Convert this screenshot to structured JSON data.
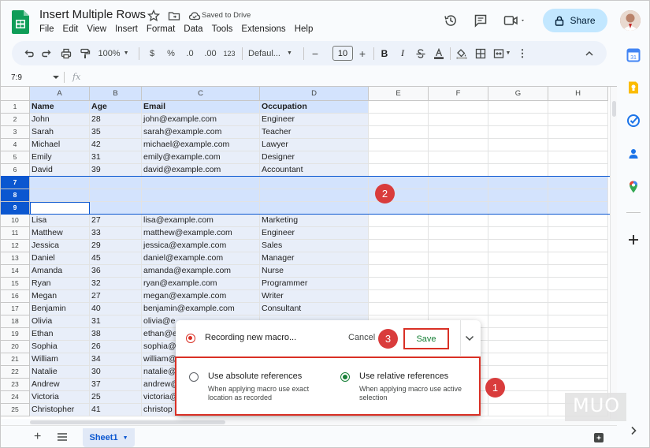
{
  "header": {
    "doc_title": "Insert Multiple Rows",
    "saved_status": "Saved to Drive",
    "share_label": "Share",
    "menu": [
      "File",
      "Edit",
      "View",
      "Insert",
      "Format",
      "Data",
      "Tools",
      "Extensions",
      "Help"
    ]
  },
  "toolbar": {
    "zoom": "100%",
    "currency": "$",
    "percent": "%",
    "decimal_decrease": ".0",
    "decimal_increase": ".00",
    "number_format": "123",
    "font": "Defaul...",
    "font_size": "10",
    "bold": "B",
    "italic": "I",
    "minus": "−",
    "plus": "+"
  },
  "formula_bar": {
    "name_box": "7:9",
    "fx": "fx"
  },
  "grid": {
    "columns": [
      "A",
      "B",
      "C",
      "D",
      "E",
      "F",
      "G",
      "H"
    ],
    "rows": [
      {
        "num": "1",
        "cells": [
          "Name",
          "Age",
          "Email",
          "Occupation"
        ]
      },
      {
        "num": "2",
        "cells": [
          "John",
          "28",
          "john@example.com",
          "Engineer"
        ]
      },
      {
        "num": "3",
        "cells": [
          "Sarah",
          "35",
          "sarah@example.com",
          "Teacher"
        ]
      },
      {
        "num": "4",
        "cells": [
          "Michael",
          "42",
          "michael@example.com",
          "Lawyer"
        ]
      },
      {
        "num": "5",
        "cells": [
          "Emily",
          "31",
          "emily@example.com",
          "Designer"
        ]
      },
      {
        "num": "6",
        "cells": [
          "David",
          "39",
          "david@example.com",
          "Accountant"
        ]
      },
      {
        "num": "7",
        "cells": [
          "",
          "",
          "",
          ""
        ]
      },
      {
        "num": "8",
        "cells": [
          "",
          "",
          "",
          ""
        ]
      },
      {
        "num": "9",
        "cells": [
          "",
          "",
          "",
          ""
        ]
      },
      {
        "num": "10",
        "cells": [
          "Lisa",
          "27",
          "lisa@example.com",
          "Marketing"
        ]
      },
      {
        "num": "11",
        "cells": [
          "Matthew",
          "33",
          "matthew@example.com",
          "Engineer"
        ]
      },
      {
        "num": "12",
        "cells": [
          "Jessica",
          "29",
          "jessica@example.com",
          "Sales"
        ]
      },
      {
        "num": "13",
        "cells": [
          "Daniel",
          "45",
          "daniel@example.com",
          "Manager"
        ]
      },
      {
        "num": "14",
        "cells": [
          "Amanda",
          "36",
          "amanda@example.com",
          "Nurse"
        ]
      },
      {
        "num": "15",
        "cells": [
          "Ryan",
          "32",
          "ryan@example.com",
          "Programmer"
        ]
      },
      {
        "num": "16",
        "cells": [
          "Megan",
          "27",
          "megan@example.com",
          "Writer"
        ]
      },
      {
        "num": "17",
        "cells": [
          "Benjamin",
          "40",
          "benjamin@example.com",
          "Consultant"
        ]
      },
      {
        "num": "18",
        "cells": [
          "Olivia",
          "31",
          "olivia@e",
          ""
        ]
      },
      {
        "num": "19",
        "cells": [
          "Ethan",
          "38",
          "ethan@e",
          ""
        ]
      },
      {
        "num": "20",
        "cells": [
          "Sophia",
          "26",
          "sophia@",
          ""
        ]
      },
      {
        "num": "21",
        "cells": [
          "William",
          "34",
          "william@",
          ""
        ]
      },
      {
        "num": "22",
        "cells": [
          "Natalie",
          "30",
          "natalie@",
          ""
        ]
      },
      {
        "num": "23",
        "cells": [
          "Andrew",
          "37",
          "andrew@",
          ""
        ]
      },
      {
        "num": "24",
        "cells": [
          "Victoria",
          "25",
          "victoria@",
          ""
        ]
      },
      {
        "num": "25",
        "cells": [
          "Christopher",
          "41",
          "christop",
          ""
        ]
      }
    ]
  },
  "sheet_tabs": {
    "active_tab": "Sheet1",
    "add_label": "+"
  },
  "macro_popup": {
    "recording_label": "Recording new macro...",
    "cancel_label": "Cancel",
    "save_label": "Save",
    "absolute_title": "Use absolute references",
    "absolute_desc": "When applying macro use exact location as recorded",
    "relative_title": "Use relative references",
    "relative_desc": "When applying macro use active selection",
    "selected": "relative"
  },
  "badges": [
    "1",
    "2",
    "3"
  ],
  "watermark": "MUO",
  "colors": {
    "accent": "#0b57d0",
    "selection": "#d3e3fd",
    "share_bg": "#c2e7ff",
    "badge": "#d93c3c",
    "save_text": "#188038",
    "sheets_green": "#0f9d58"
  }
}
